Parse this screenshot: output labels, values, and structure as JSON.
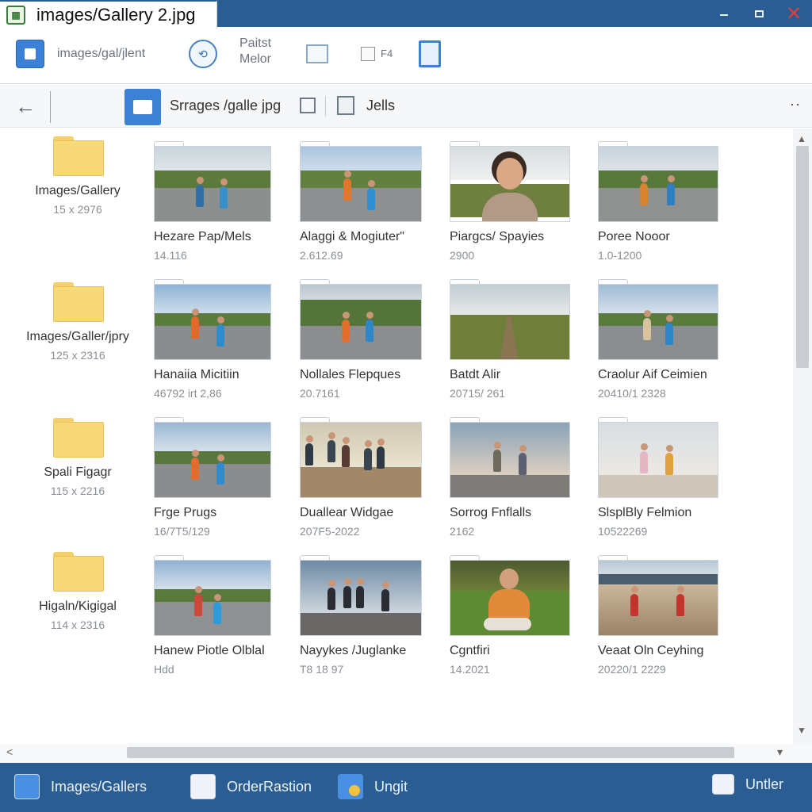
{
  "window": {
    "title": "images/Gallery 2.jpg",
    "app_icon_glyph": "▦",
    "controls": {
      "close_glyph": "✕"
    }
  },
  "ribbon": {
    "items": [
      {
        "label": "images/gal/jlent",
        "icon": "home-icon"
      },
      {
        "label": "Paitst\nMelor",
        "icon": "share-icon"
      },
      {
        "label": "",
        "icon": "organize-icon"
      },
      {
        "label": "F4",
        "icon": "page-icon"
      },
      {
        "label": "",
        "icon": "book-icon"
      }
    ]
  },
  "address": {
    "back_glyph": "←",
    "path": "Srrages /galle jpg",
    "secondary": "Jells",
    "more_glyph": "··"
  },
  "folders": [
    {
      "name": "Images/Gallery",
      "meta": "15 x 2976"
    },
    {
      "name": "Images/Galler/jpry",
      "meta": "125 x 2316"
    },
    {
      "name": "Spali Figagr",
      "meta": "115 x 2216"
    },
    {
      "name": "Higaln/Kigigal",
      "meta": "114 x 2316"
    }
  ],
  "tiles": [
    {
      "name": "Hezare Pap/Mels",
      "meta": "14.116"
    },
    {
      "name": "Alaggi & Mogiuter\"",
      "meta": "2.612.69"
    },
    {
      "name": "Piargcs/ Spayies",
      "meta": "2900"
    },
    {
      "name": "Poree Nooor",
      "meta": "1.0-1200"
    },
    {
      "name": "Hanaiia Micitiin",
      "meta": "46792 irt 2,86"
    },
    {
      "name": "Nollales Flepques",
      "meta": "20.7161"
    },
    {
      "name": "Batdt Alir",
      "meta": "20715/ 261"
    },
    {
      "name": "Craolur Aif Ceimien",
      "meta": "20410/1 2328"
    },
    {
      "name": "Frge Prugs",
      "meta": "16/7T5/129"
    },
    {
      "name": "Duallear Widgae",
      "meta": "207F5-2022"
    },
    {
      "name": "Sorrog Fnflalls",
      "meta": "2162"
    },
    {
      "name": "SlsplBly Felmion",
      "meta": "10522269"
    },
    {
      "name": "Hanew Piotle Olblal",
      "meta": "Hdd"
    },
    {
      "name": "Nayykes /Juglanke",
      "meta": "T8 18 97"
    },
    {
      "name": "Cgntfiri",
      "meta": "14.2021"
    },
    {
      "name": "Veaat Oln Ceyhing",
      "meta": "20220/1 2229"
    }
  ],
  "scroll": {
    "up_glyph": "▲",
    "down_glyph": "▼",
    "left_glyph": "<",
    "right_glyph": "▾"
  },
  "taskbar": {
    "items": [
      {
        "label": "Images/Gallers",
        "icon": "gallery-icon"
      },
      {
        "label": "OrderRastion",
        "icon": "order-icon"
      },
      {
        "label": "Ungit",
        "icon": "coin-folder-icon"
      },
      {
        "label": "Untler",
        "icon": "monitor-icon"
      }
    ]
  },
  "colors": {
    "titlebar": "#2a5d92",
    "accent": "#3b82d6",
    "folder": "#f7d978",
    "close": "#e33d3d"
  }
}
